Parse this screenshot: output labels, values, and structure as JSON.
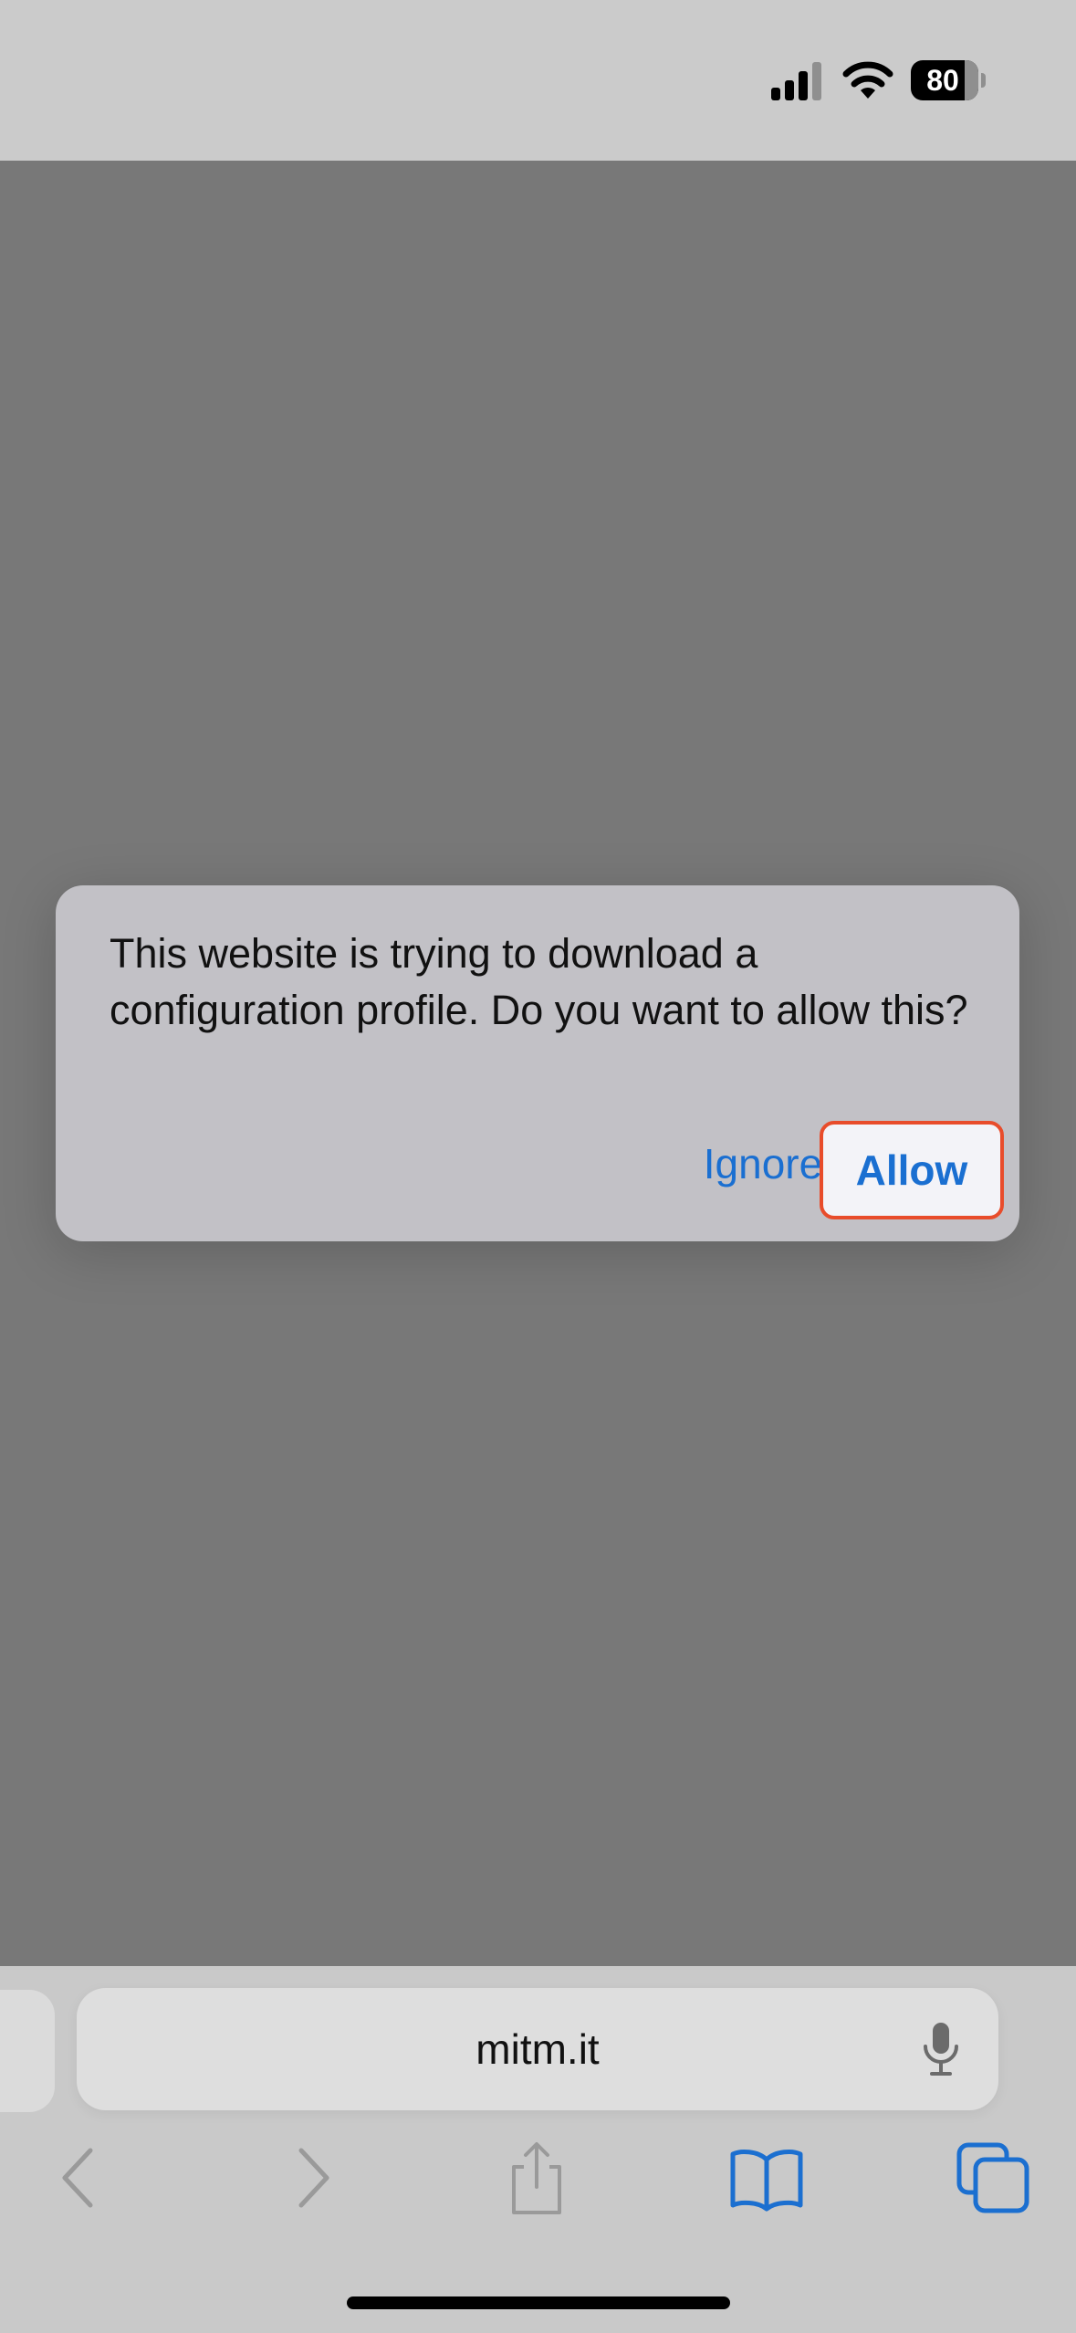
{
  "status_bar": {
    "battery_level": "80",
    "signal_icon": "cellular-signal-icon",
    "wifi_icon": "wifi-icon"
  },
  "alert": {
    "message": "This website is trying to download a configuration profile. Do you want to allow this?",
    "ignore_label": "Ignore",
    "allow_label": "Allow",
    "highlight_color": "#e84c2b",
    "accent_color": "#1a6fd1"
  },
  "address_bar": {
    "url": "mitm.it",
    "mic_icon": "microphone-icon"
  },
  "toolbar": {
    "icons": [
      "back-icon",
      "forward-icon",
      "share-icon",
      "bookmarks-icon",
      "tabs-icon"
    ]
  }
}
